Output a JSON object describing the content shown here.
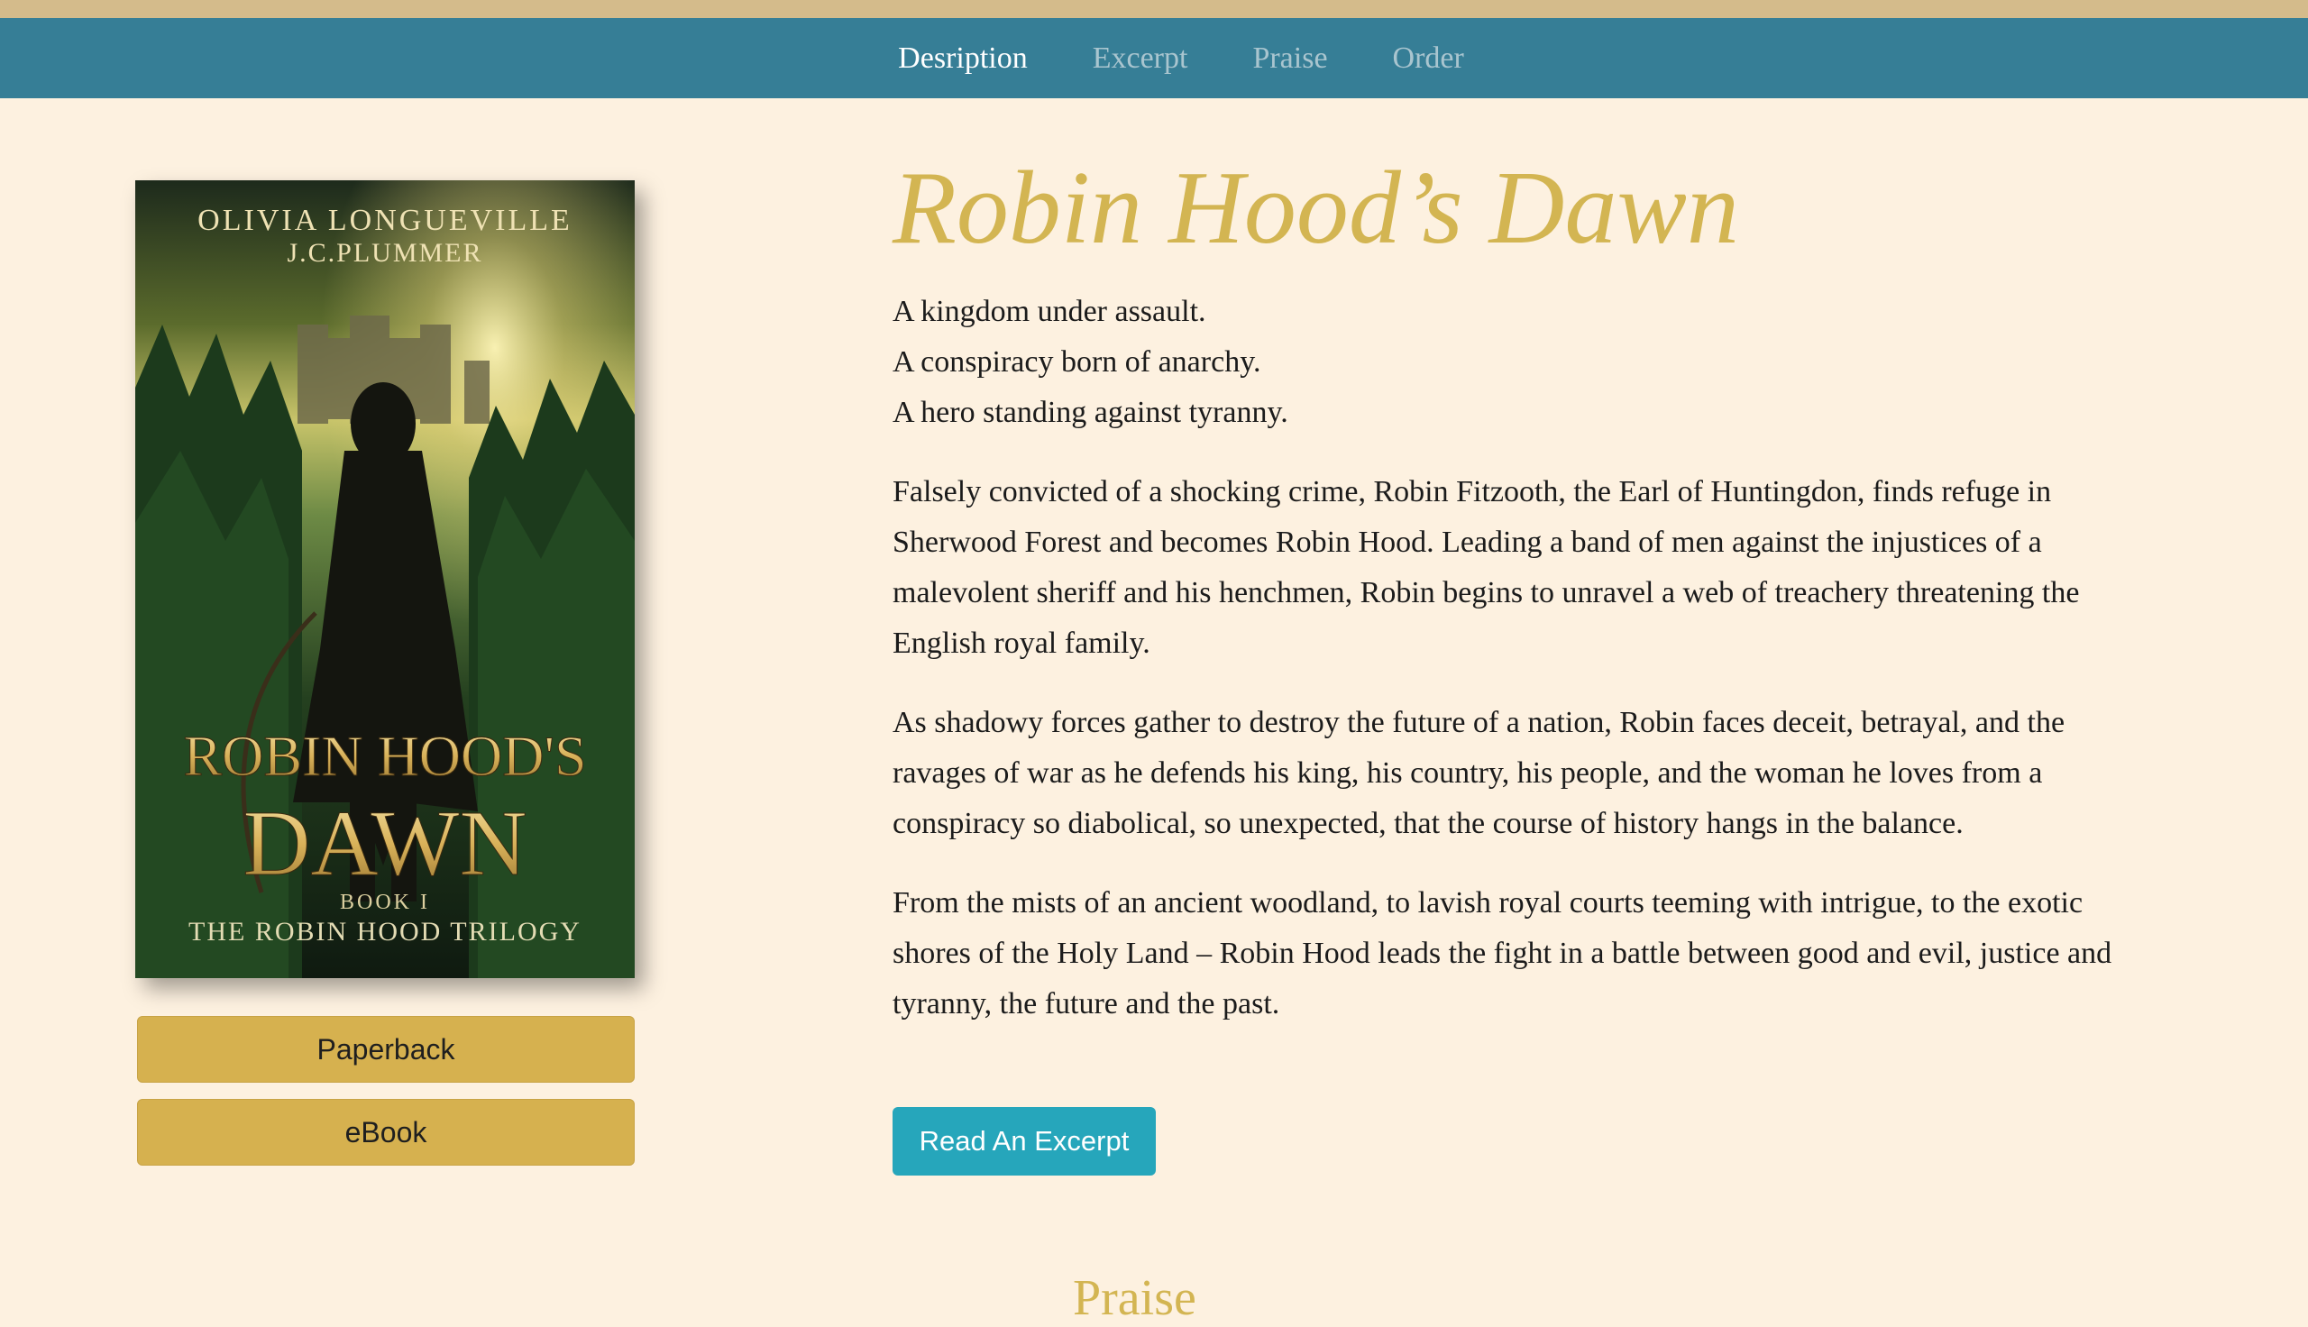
{
  "nav": {
    "items": [
      {
        "label": "Desription",
        "active": true
      },
      {
        "label": "Excerpt",
        "active": false
      },
      {
        "label": "Praise",
        "active": false
      },
      {
        "label": "Order",
        "active": false
      }
    ]
  },
  "cover": {
    "authors": [
      "OLIVIA LONGUEVILLE",
      "J.C.PLUMMER"
    ],
    "title_line1": "ROBIN HOOD'S",
    "title_line2": "DAWN",
    "book_number": "BOOK I",
    "series": "THE ROBIN HOOD TRILOGY"
  },
  "buy": {
    "paperback_label": "Paperback",
    "ebook_label": "eBook"
  },
  "book": {
    "title": "Robin Hood’s Dawn",
    "tagline": [
      "A kingdom under assault.",
      "A conspiracy born of anarchy.",
      "A hero standing against tyranny."
    ],
    "paragraphs": [
      "Falsely convicted of a shocking crime, Robin Fitzooth, the Earl of Huntingdon, finds refuge in Sherwood Forest and becomes Robin Hood. Leading a band of men against the injustices of a malevolent sheriff and his henchmen, Robin begins to unravel a web of treachery threatening the English royal family.",
      "As shadowy forces gather to destroy the future of a nation, Robin faces deceit, betrayal, and the ravages of war as he defends his king, his country, his people, and the woman he loves from a conspiracy so diabolical, so unexpected, that the course of history hangs in the balance.",
      "From the mists of an ancient woodland, to lavish royal courts teeming with intrigue, to the exotic shores of the Holy Land – Robin Hood leads the fight in a battle between good and evil, justice and tyranny, the future and the past."
    ],
    "excerpt_button": "Read An Excerpt"
  },
  "next_section": {
    "heading": "Praise"
  },
  "colors": {
    "nav_bg": "#367e96",
    "top_strip": "#d4bb8b",
    "page_bg": "#fdf1e0",
    "title_gold": "#d3b552",
    "buy_button": "#d6b14f",
    "excerpt_button": "#26a6bb"
  }
}
